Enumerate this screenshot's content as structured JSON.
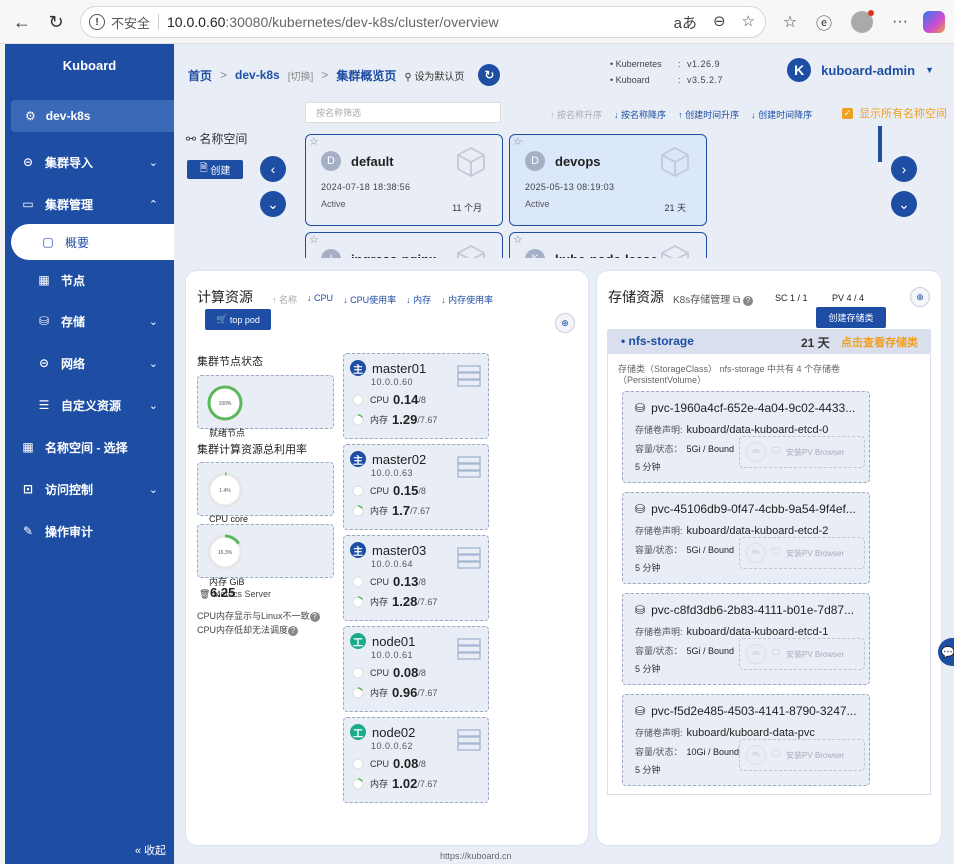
{
  "browser": {
    "insecure_label": "不安全",
    "url_host": "10.0.0.60",
    "url_rest": ":30080/kubernetes/dev-k8s/cluster/overview"
  },
  "sidebar": {
    "brand": "Kuboard",
    "cluster": "dev-k8s",
    "items": [
      {
        "label": "集群导入",
        "icon": "link-icon"
      },
      {
        "label": "集群管理",
        "icon": "briefcase-icon"
      },
      {
        "label": "概要",
        "icon": "monitor-icon"
      },
      {
        "label": "节点",
        "icon": "grid-icon"
      },
      {
        "label": "存储",
        "icon": "database-icon"
      },
      {
        "label": "网络",
        "icon": "link-icon"
      },
      {
        "label": "自定义资源",
        "icon": "sliders-icon"
      },
      {
        "label": "名称空间 - 选择",
        "icon": "grid-icon"
      },
      {
        "label": "访问控制",
        "icon": "lock-icon"
      },
      {
        "label": "操作审计",
        "icon": "edit-icon"
      }
    ],
    "collapse": "收起"
  },
  "topbar": {
    "home": "首页",
    "cluster": "dev-k8s",
    "switch": "[切换]",
    "page": "集群概览页",
    "set_default": "设为默认页",
    "kubernetes_label": "Kubernetes",
    "kubernetes_version": "v1.26.9",
    "kuboard_label": "Kuboard",
    "kuboard_version": "v3.5.2.7",
    "user_initial": "K",
    "user": "kuboard-admin"
  },
  "namespaces": {
    "title": "名称空间",
    "create": "创建",
    "filter_placeholder": "按名称筛选",
    "sorts": [
      "按名称升序",
      "按名称降序",
      "创建时间升序",
      "创建时间降序"
    ],
    "show_all": "显示所有名称空间",
    "cards": [
      {
        "initial": "D",
        "name": "default",
        "created": "2024-07-18 18:38:56",
        "status": "Active",
        "age": "11 个月"
      },
      {
        "initial": "D",
        "name": "devops",
        "created": "2025-05-13 08:19:03",
        "status": "Active",
        "age": "21 天"
      },
      {
        "initial": "I",
        "name": "ingress-nginx",
        "created": "",
        "status": "",
        "age": ""
      },
      {
        "initial": "K",
        "name": "kube-node-lease",
        "created": "",
        "status": "",
        "age": ""
      }
    ]
  },
  "compute": {
    "title": "计算资源",
    "sorts": [
      "名称",
      "CPU",
      "CPU使用率",
      "内存",
      "内存使用率"
    ],
    "top_pod": "top pod",
    "node_status_label": "集群节点状态",
    "ready_pct": "100%",
    "ready_label": "就绪节点",
    "usage_label": "集群计算资源总利用率",
    "cpu_pct": "1.4%",
    "cpu_label": "CPU core",
    "mem_pct": "16.3%",
    "mem_label": "内存 GiB",
    "metrics_server": "Metrics Server",
    "mem_total_overlay": "6.25",
    "note1": "CPU内存显示与Linux不一致",
    "note2": "CPU内存低却无法调度",
    "cpu_text": "CPU",
    "mem_text": "内存",
    "nodes": [
      {
        "name": "master01",
        "ip": "10.0.0.60",
        "role": "主",
        "cpu": "0.14",
        "cpu_total": "/8",
        "mem": "1.29",
        "mem_total": "/7.67"
      },
      {
        "name": "master02",
        "ip": "10.0.0.63",
        "role": "主",
        "cpu": "0.15",
        "cpu_total": "/8",
        "mem": "1.7",
        "mem_total": "/7.67"
      },
      {
        "name": "master03",
        "ip": "10.0.0.64",
        "role": "主",
        "cpu": "0.13",
        "cpu_total": "/8",
        "mem": "1.28",
        "mem_total": "/7.67"
      },
      {
        "name": "node01",
        "ip": "10.0.0.61",
        "role": "工",
        "cpu": "0.08",
        "cpu_total": "/8",
        "mem": "0.96",
        "mem_total": "/7.67"
      },
      {
        "name": "node02",
        "ip": "10.0.0.62",
        "role": "工",
        "cpu": "0.08",
        "cpu_total": "/8",
        "mem": "1.02",
        "mem_total": "/7.67"
      }
    ],
    "colors": {
      "master": "#1e4ea3",
      "worker": "#1aab8a",
      "ring": "#5cb85c"
    }
  },
  "storage": {
    "title": "存储资源",
    "k8s_link": "K8s存储管理",
    "sc_count": "SC 1 / 1",
    "pv_count": "PV 4 / 4",
    "create_sc": "创建存储类",
    "sc_name": "nfs-storage",
    "sc_age": "21 天",
    "view_sc": "点击查看存储类",
    "desc1": "存储类（StorageClass） nfs-storage 中共有 4 个存储卷",
    "desc2": "（PersistentVolume）",
    "claim_label": "存储卷声明:",
    "cap_label": "容量/状态：",
    "browse": "安装PV Browser",
    "browse_pct": "0%",
    "pvs": [
      {
        "name": "pvc-1960a4cf-652e-4a04-9c02-4433...",
        "claim": "kuboard/data-kuboard-etcd-0",
        "cap": "5Gi / Bound",
        "age": "5 分钟"
      },
      {
        "name": "pvc-45106db9-0f47-4cbb-9a54-9f4ef...",
        "claim": "kuboard/data-kuboard-etcd-2",
        "cap": "5Gi / Bound",
        "age": "5 分钟"
      },
      {
        "name": "pvc-c8fd3db6-2b83-4111-b01e-7d87...",
        "claim": "kuboard/data-kuboard-etcd-1",
        "cap": "5Gi / Bound",
        "age": "5 分钟"
      },
      {
        "name": "pvc-f5d2e485-4503-4141-8790-3247...",
        "claim": "kuboard/kuboard-data-pvc",
        "cap": "10Gi / Bound",
        "age": "5 分钟"
      }
    ]
  },
  "footer": "https://kuboard.cn"
}
